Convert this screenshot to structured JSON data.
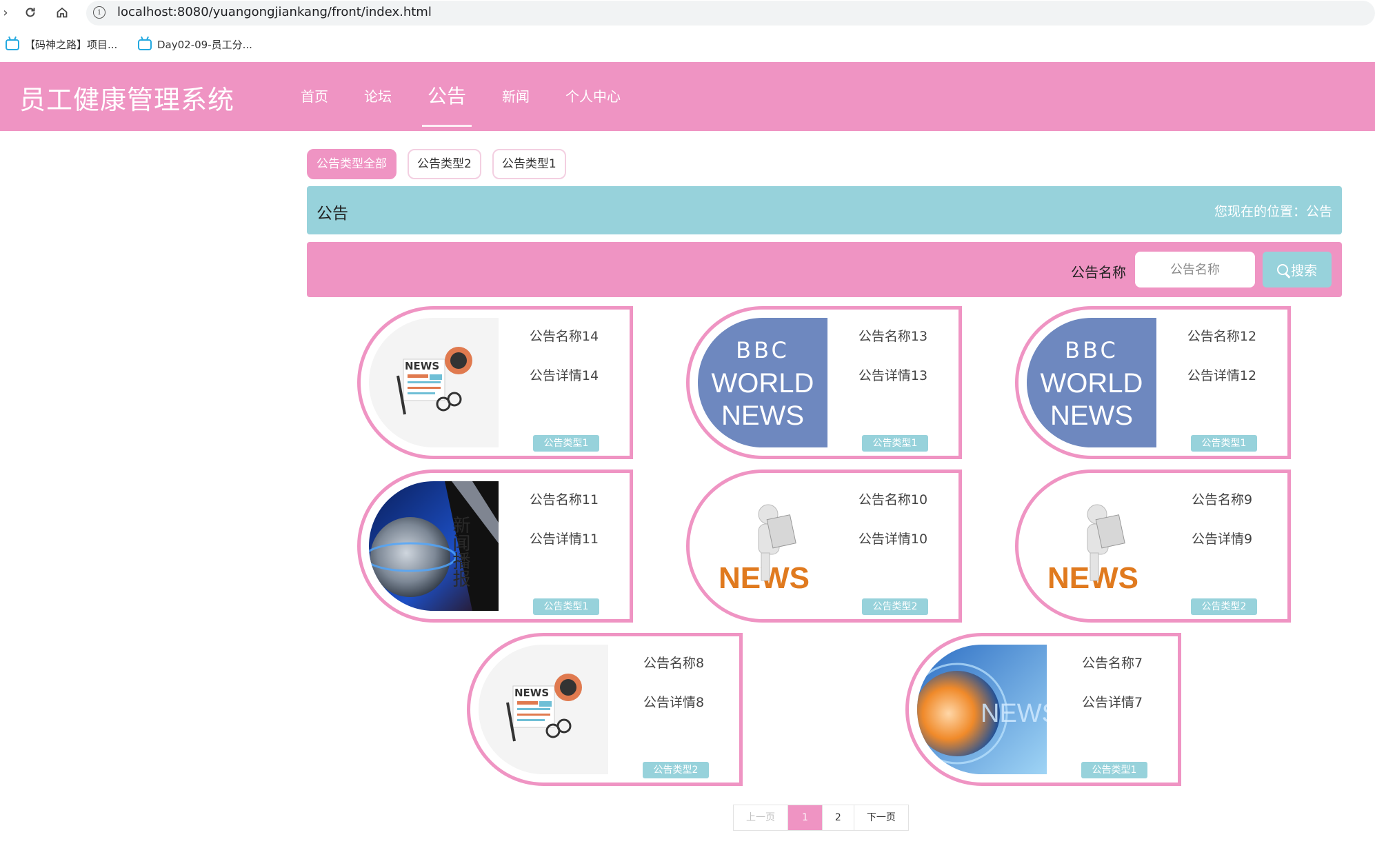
{
  "browser": {
    "url": "localhost:8080/yuangongjiankang/front/index.html",
    "bookmarks": [
      {
        "label": "【码神之路】项目..."
      },
      {
        "label": "Day02-09-员工分..."
      }
    ]
  },
  "header": {
    "logo": "员工健康管理系统",
    "menu": [
      {
        "label": "首页"
      },
      {
        "label": "论坛"
      },
      {
        "label": "公告"
      },
      {
        "label": "新闻"
      },
      {
        "label": "个人中心"
      }
    ],
    "active_menu": "公告"
  },
  "tabs": [
    {
      "label": "公告类型全部",
      "active": true
    },
    {
      "label": "公告类型2",
      "active": false
    },
    {
      "label": "公告类型1",
      "active": false
    }
  ],
  "titlebar": {
    "title": "公告",
    "location": "您现在的位置：公告"
  },
  "search": {
    "label": "公告名称",
    "placeholder": "公告名称",
    "button": "搜索"
  },
  "cards": [
    {
      "name": "公告名称14",
      "detail": "公告详情14",
      "type": "公告类型1",
      "image": "news-paper"
    },
    {
      "name": "公告名称13",
      "detail": "公告详情13",
      "type": "公告类型1",
      "image": "bbc-world-news"
    },
    {
      "name": "公告名称12",
      "detail": "公告详情12",
      "type": "公告类型1",
      "image": "bbc-world-news"
    },
    {
      "name": "公告名称11",
      "detail": "公告详情11",
      "type": "公告类型1",
      "image": "globe-broadcast"
    },
    {
      "name": "公告名称10",
      "detail": "公告详情10",
      "type": "公告类型2",
      "image": "news-figure"
    },
    {
      "name": "公告名称9",
      "detail": "公告详情9",
      "type": "公告类型2",
      "image": "news-figure"
    },
    {
      "name": "公告名称8",
      "detail": "公告详情8",
      "type": "公告类型2",
      "image": "news-paper"
    },
    {
      "name": "公告名称7",
      "detail": "公告详情7",
      "type": "公告类型1",
      "image": "globe-news"
    }
  ],
  "image_text": {
    "news": "NEWS",
    "bbc_1": "BBC",
    "bbc_2": "WORLD",
    "bbc_3": "NEWS",
    "broadcast": "新闻播报"
  },
  "pagination": {
    "prev": "上一页",
    "pages": [
      "1",
      "2"
    ],
    "current": "1",
    "next": "下一页"
  },
  "colors": {
    "pink": "#ef94c3",
    "teal": "#97d2db",
    "bbc_blue": "#6e88bf"
  }
}
